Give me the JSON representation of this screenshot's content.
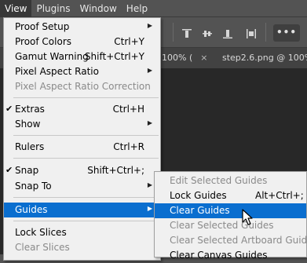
{
  "menubar": {
    "items": [
      {
        "label": "View",
        "active": true
      },
      {
        "label": "Plugins"
      },
      {
        "label": "Window"
      },
      {
        "label": "Help"
      }
    ]
  },
  "tabs": [
    {
      "label": "100% (",
      "close": "×"
    },
    {
      "label": "step2.6.png @ 100%"
    }
  ],
  "toolbar": {
    "more_label": "•••"
  },
  "view_menu": {
    "items": [
      {
        "label": "Proof Setup",
        "shortcut": "",
        "submenu": true
      },
      {
        "label": "Proof Colors",
        "shortcut": "Ctrl+Y"
      },
      {
        "label": "Gamut Warning",
        "shortcut": "Shift+Ctrl+Y"
      },
      {
        "label": "Pixel Aspect Ratio",
        "shortcut": "",
        "submenu": true
      },
      {
        "label": "Pixel Aspect Ratio Correction",
        "disabled": true
      },
      {
        "label": "Extras",
        "shortcut": "Ctrl+H",
        "checked": true
      },
      {
        "label": "Show",
        "submenu": true
      },
      {
        "label": "Rulers",
        "shortcut": "Ctrl+R"
      },
      {
        "label": "Snap",
        "shortcut": "Shift+Ctrl+;",
        "checked": true
      },
      {
        "label": "Snap To",
        "submenu": true
      },
      {
        "label": "Guides",
        "submenu": true,
        "highlighted": true
      },
      {
        "label": "Lock Slices"
      },
      {
        "label": "Clear Slices",
        "disabled": true
      }
    ]
  },
  "guides_submenu": {
    "items": [
      {
        "label": "Edit Selected Guides",
        "disabled": true
      },
      {
        "label": "Lock Guides",
        "shortcut": "Alt+Ctrl+;"
      },
      {
        "label": "Clear Guides",
        "highlighted": true
      },
      {
        "label": "Clear Selected Guides",
        "disabled": true
      },
      {
        "label": "Clear Selected Artboard Guides",
        "disabled": true
      },
      {
        "label": "Clear Canvas Guides"
      }
    ]
  },
  "glyphs": {
    "check": "✔",
    "arrow": "▶"
  },
  "colors": {
    "highlight": "#0a6ecf",
    "menu_bg": "#f0f0f0",
    "app_bg": "#535353"
  }
}
